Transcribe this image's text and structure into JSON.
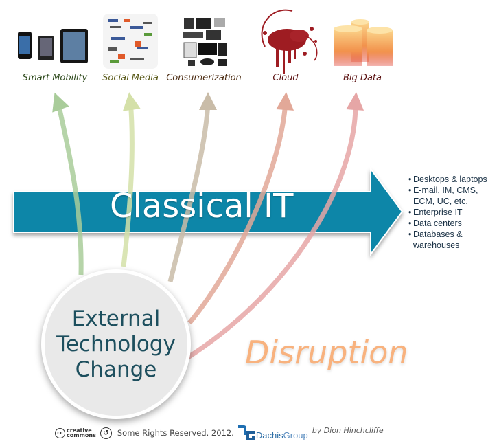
{
  "topics": [
    {
      "label": "Smart Mobility",
      "icon": "smartphones-tablet-icon",
      "label_color": "#2e4a1c",
      "arrow_color": "#a9cc9a"
    },
    {
      "label": "Social Media",
      "icon": "social-logos-collage-icon",
      "label_color": "#5a5a1a",
      "arrow_color": "#d4e0a8"
    },
    {
      "label": "Consumerization",
      "icon": "consumer-electronics-icon",
      "label_color": "#4a2a10",
      "arrow_color": "#c9bca8"
    },
    {
      "label": "Cloud",
      "icon": "ink-splatter-icon",
      "label_color": "#5a1010",
      "arrow_color": "#e2a898"
    },
    {
      "label": "Big Data",
      "icon": "database-cylinders-icon",
      "label_color": "#5a1010",
      "arrow_color": "#e6a6a6"
    }
  ],
  "classical_it": {
    "label": "Classical IT",
    "color": "#0a86a8",
    "bullets": [
      "Desktops & laptops",
      "E-mail, IM, CMS, ECM, UC, etc.",
      "Enterprise IT",
      "Data centers",
      "Databases & warehouses"
    ]
  },
  "center_circle": {
    "lines": [
      "External",
      "Technology",
      "Change"
    ]
  },
  "disruption_label": "Disruption",
  "footer": {
    "cc_top": "creative",
    "cc_bottom": "commons",
    "cc_badge": "cc",
    "rights": "Some Rights Reserved. 2012.",
    "company_main": "Dachis",
    "company_sub": "Group",
    "byline": "by Dion Hinchcliffe"
  }
}
